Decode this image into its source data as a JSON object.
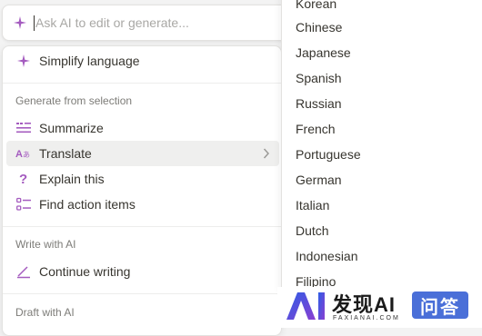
{
  "search": {
    "placeholder": "Ask AI to edit or generate..."
  },
  "menu": {
    "top_item": "Simplify language",
    "section_generate": "Generate from selection",
    "generate_items": [
      {
        "label": "Summarize",
        "icon": "summarize-icon"
      },
      {
        "label": "Translate",
        "icon": "translate-icon"
      },
      {
        "label": "Explain this",
        "icon": "question-icon"
      },
      {
        "label": "Find action items",
        "icon": "checklist-icon"
      }
    ],
    "section_write": "Write with AI",
    "write_items": [
      {
        "label": "Continue writing",
        "icon": "pen-icon"
      }
    ],
    "section_draft": "Draft with AI"
  },
  "languages": [
    "Korean",
    "Chinese",
    "Japanese",
    "Spanish",
    "Russian",
    "French",
    "Portuguese",
    "German",
    "Italian",
    "Dutch",
    "Indonesian",
    "Filipino"
  ],
  "colors": {
    "accent": "#a45bbf",
    "hover": "#efefee",
    "muted_text": "#7d7c78",
    "placeholder": "#a9a8a5"
  },
  "watermark": {
    "title": "发现AI",
    "subtitle": "FAXIANAI.COM",
    "badge": "问答"
  }
}
